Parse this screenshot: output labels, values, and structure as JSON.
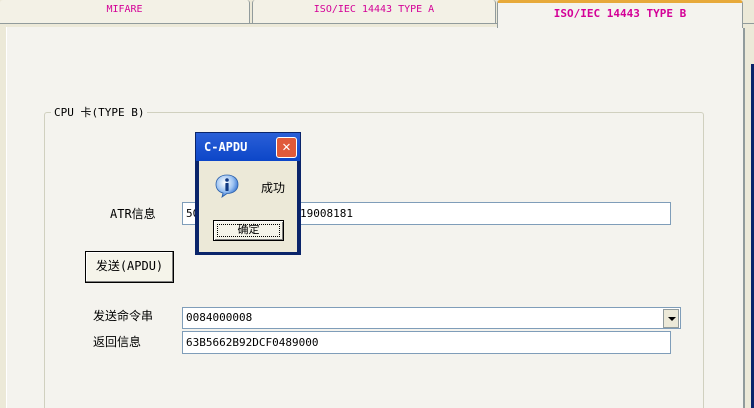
{
  "tabs": [
    {
      "label": "MIFARE"
    },
    {
      "label": "ISO/IEC 14443 TYPE A"
    },
    {
      "label": "ISO/IEC 14443 TYPE B"
    }
  ],
  "active_tab": 2,
  "group": {
    "title": "CPU 卡(TYPE B)"
  },
  "atr": {
    "label": "ATR信息",
    "value_left": "50",
    "value_right": "19008181"
  },
  "send_button": {
    "label": "发送(APDU)"
  },
  "command": {
    "label": "发送命令串",
    "value": "0084000008"
  },
  "response": {
    "label": "返回信息",
    "value": "63B5662B92DCF0489000"
  },
  "dialog": {
    "title": "C-APDU",
    "message": "成功",
    "ok_label": "确定",
    "icon": "info-icon"
  },
  "colors": {
    "tab_text": "#d40097",
    "active_tab_accent": "#e7a93a",
    "dialog_titlebar": "#0c46c8"
  }
}
